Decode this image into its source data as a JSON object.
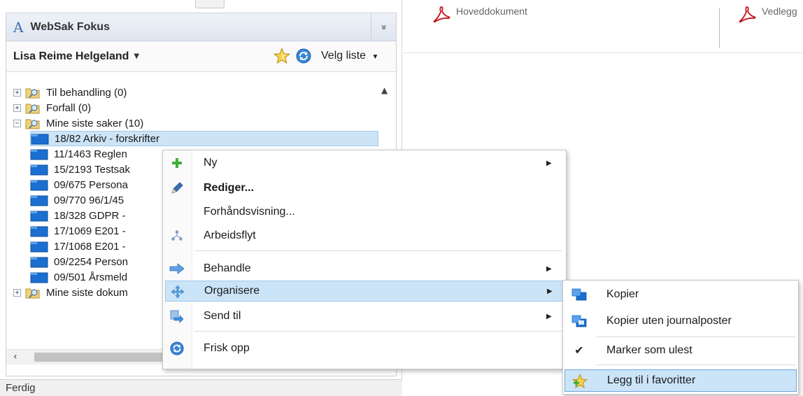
{
  "panel": {
    "title": "WebSak Fokus",
    "collapse_glyph": "»",
    "user_name": "Lisa Reime Helgeland",
    "list_selector_label": "Velg liste"
  },
  "tree": {
    "nodes": [
      {
        "label": "Til behandling (0)",
        "expander": "+"
      },
      {
        "label": "Forfall (0)",
        "expander": "+"
      },
      {
        "label": "Mine siste saker (10)",
        "expander": "−"
      },
      {
        "label": "18/82 Arkiv - forskrifter"
      },
      {
        "label": "11/1463 Reglen"
      },
      {
        "label": "15/2193 Testsak"
      },
      {
        "label": "09/675 Persona"
      },
      {
        "label": "09/770 96/1/45"
      },
      {
        "label": "18/328 GDPR -"
      },
      {
        "label": "17/1069 E201 -"
      },
      {
        "label": "17/1068 E201 -"
      },
      {
        "label": "09/2254 Person"
      },
      {
        "label": "09/501 Årsmeld"
      },
      {
        "label": "Mine siste dokum",
        "expander": "+"
      }
    ]
  },
  "status": {
    "text": "Ferdig"
  },
  "doc_tabs": [
    {
      "label": "Hoveddokument",
      "icon": "pdf-icon"
    },
    {
      "label": "Vedlegg",
      "icon": "pdf-icon"
    }
  ],
  "context_menu": {
    "items": [
      {
        "label": "Ny",
        "icon": "plus-icon",
        "submenu": true
      },
      {
        "label": "Rediger...",
        "icon": "pencil-icon",
        "bold": true
      },
      {
        "label": "Forhåndsvisning...",
        "icon": ""
      },
      {
        "label": "Arbeidsflyt",
        "icon": "workflow-icon"
      },
      {
        "label": "Behandle",
        "icon": "arrow-right-icon",
        "submenu": true
      },
      {
        "label": "Organisere",
        "icon": "organize-icon",
        "submenu": true,
        "highlighted": true
      },
      {
        "label": "Send til",
        "icon": "send-icon",
        "submenu": true
      },
      {
        "label": "Frisk opp",
        "icon": "refresh-icon"
      }
    ]
  },
  "submenu": {
    "items": [
      {
        "label": "Kopier",
        "icon": "copy-folder-icon"
      },
      {
        "label": "Kopier uten journalposter",
        "icon": "copy-folder-plain-icon"
      },
      {
        "label": "Marker som ulest",
        "icon": "checkmark-icon"
      },
      {
        "label": "Legg til i favoritter",
        "icon": "add-favorite-icon",
        "highlighted": true
      }
    ]
  },
  "colors": {
    "selection_bg": "#cce4f8",
    "selection_border": "#9cc8ee",
    "case_folder_blue": "#1a6fd0",
    "pdf_red": "#c4121a",
    "app_accent": "#3b6fb6"
  }
}
